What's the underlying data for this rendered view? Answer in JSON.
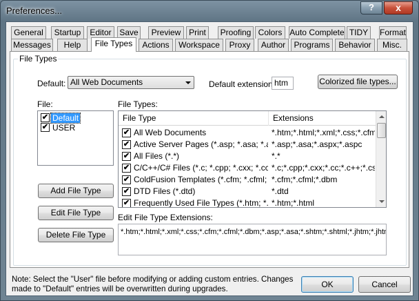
{
  "window": {
    "title": "Preferences...",
    "help_label": "?",
    "close_label": "x"
  },
  "tabs_row1": [
    "General",
    "Startup",
    "Editor",
    "Save",
    "Preview",
    "Print",
    "Proofing",
    "Colors",
    "Auto Complete",
    "TIDY",
    "Format"
  ],
  "tabs_row2": [
    "Messages",
    "Help",
    "File Types",
    "Actions",
    "Workspace",
    "Proxy",
    "Author",
    "Programs",
    "Behavior",
    "Misc."
  ],
  "selected_tab": "File Types",
  "group": {
    "label": "File Types"
  },
  "default": {
    "label": "Default:",
    "value": "All Web Documents"
  },
  "default_extension": {
    "label": "Default extension:",
    "value": "htm"
  },
  "colorized_button": "Colorized file types...",
  "file": {
    "label": "File:",
    "items": [
      {
        "name": "Default",
        "checked": true,
        "selected": true
      },
      {
        "name": "USER",
        "checked": true,
        "selected": false
      }
    ],
    "add_button": "Add File Type",
    "edit_button": "Edit File Type",
    "delete_button": "Delete File Type"
  },
  "file_types": {
    "label": "File Types:",
    "columns": [
      "File Type",
      "Extensions"
    ],
    "rows": [
      {
        "type": "All Web Documents",
        "ext": "*.htm;*.html;*.xml;*.css;*.cfm;*.c...",
        "checked": true
      },
      {
        "type": "Active Server Pages (*.asp; *.asa; *.as...",
        "ext": "*.asp;*.asa;*.aspx;*.aspc",
        "checked": true
      },
      {
        "type": "All Files (*.*)",
        "ext": "*.*",
        "checked": true
      },
      {
        "type": "C/C++/C# Files (*.c; *.cpp; *.cxx; *.cc;...",
        "ext": "*.c;*.cpp;*.cxx;*.cc;*.c++;*.cs;*...",
        "checked": true
      },
      {
        "type": "ColdFusion Templates (*.cfm; *.cfml; *...",
        "ext": "*.cfm;*.cfml;*.dbm",
        "checked": true
      },
      {
        "type": "DTD Files (*.dtd)",
        "ext": "*.dtd",
        "checked": true
      },
      {
        "type": "Frequently Used File Types (*.htm; *.ht...",
        "ext": "*.htm;*.html",
        "checked": true
      }
    ]
  },
  "edit_extensions": {
    "label": "Edit File Type Extensions:",
    "value": "*.htm;*.html;*.xml;*.css;*.cfm;*.cfml;*.dbm;*.asp;*.asa;*.shtm;*.shtml;*.jhtm;*.jhtml;*.j"
  },
  "note": "Note: Select the \"User\" file before modifying or adding custom entries. Changes made to \"Default\" entries will be overwritten during upgrades.",
  "ok_button": "OK",
  "cancel_button": "Cancel",
  "check_glyph": "✔"
}
